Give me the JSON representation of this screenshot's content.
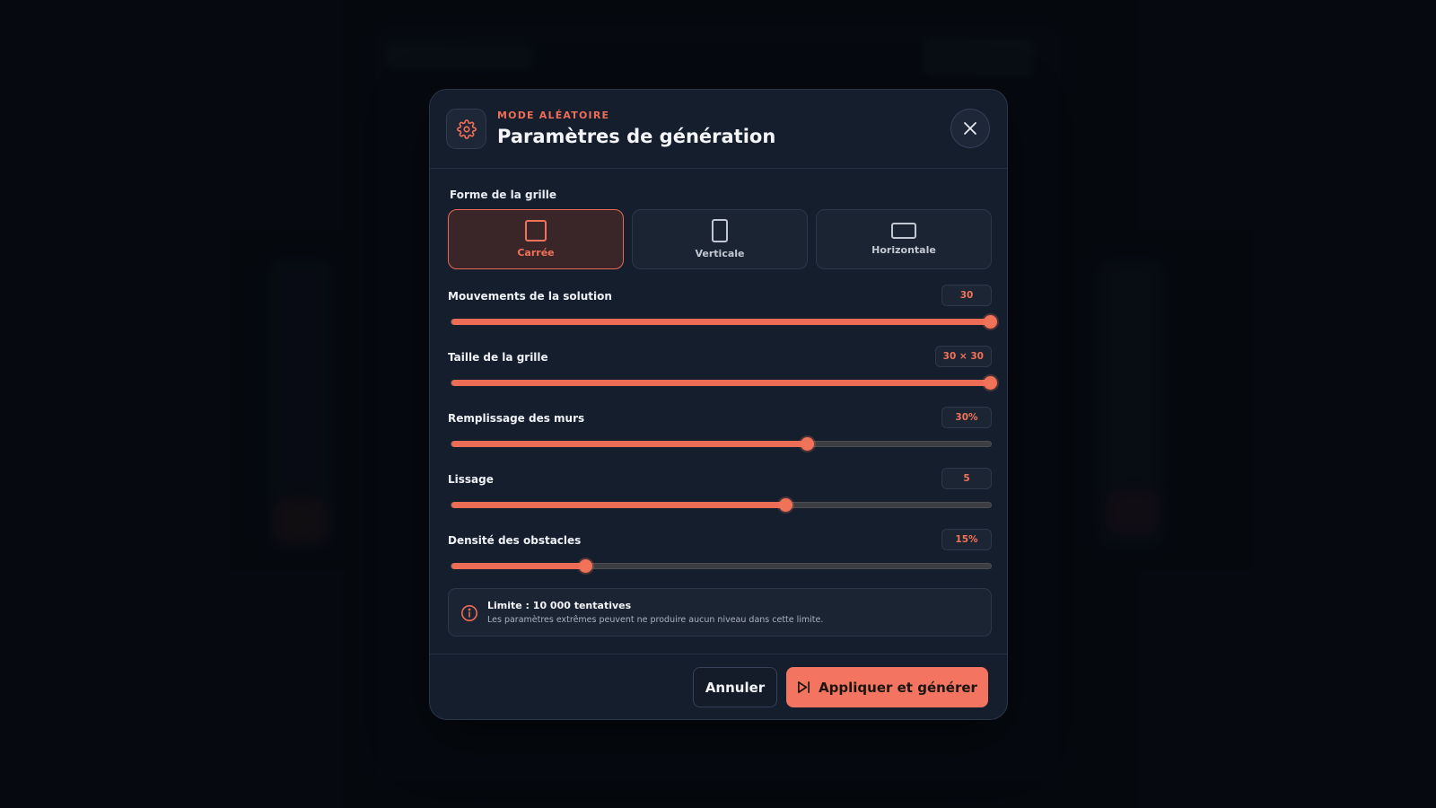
{
  "modal": {
    "eyebrow": "MODE ALÉATOIRE",
    "title": "Paramètres de génération",
    "icons": {
      "header": "gear-icon",
      "close": "close-icon"
    }
  },
  "grid_shape": {
    "label": "Forme de la grille",
    "selected": "Carrée",
    "options": [
      {
        "label": "Carrée",
        "icon": "square-shape-icon",
        "active": true
      },
      {
        "label": "Verticale",
        "icon": "portrait-shape-icon",
        "active": false
      },
      {
        "label": "Horizontale",
        "icon": "landscape-shape-icon",
        "active": false
      }
    ]
  },
  "sliders": [
    {
      "id": "solution-moves",
      "label": "Mouvements de la solution",
      "value": "30",
      "fraction": 1.0
    },
    {
      "id": "grid-size",
      "label": "Taille de la grille",
      "value": "30 × 30",
      "fraction": 1.0
    },
    {
      "id": "wall-fill",
      "label": "Remplissage des murs",
      "value": "30%",
      "fraction": 0.66
    },
    {
      "id": "smoothing",
      "label": "Lissage",
      "value": "5",
      "fraction": 0.62
    },
    {
      "id": "obstacle-density",
      "label": "Densité des obstacles",
      "value": "15%",
      "fraction": 0.25
    }
  ],
  "info": {
    "title": "Limite : 10 000 tentatives",
    "text": "Les paramètres extrêmes peuvent ne produire aucun niveau dans cette limite.",
    "icon": "info-icon"
  },
  "footer": {
    "cancel_label": "Annuler",
    "apply_label": "Appliquer et générer",
    "apply_icon": "play-skip-icon"
  },
  "colors": {
    "accent": "#f07259",
    "modal_bg": "#151e2d",
    "page_bg": "#070b12"
  }
}
